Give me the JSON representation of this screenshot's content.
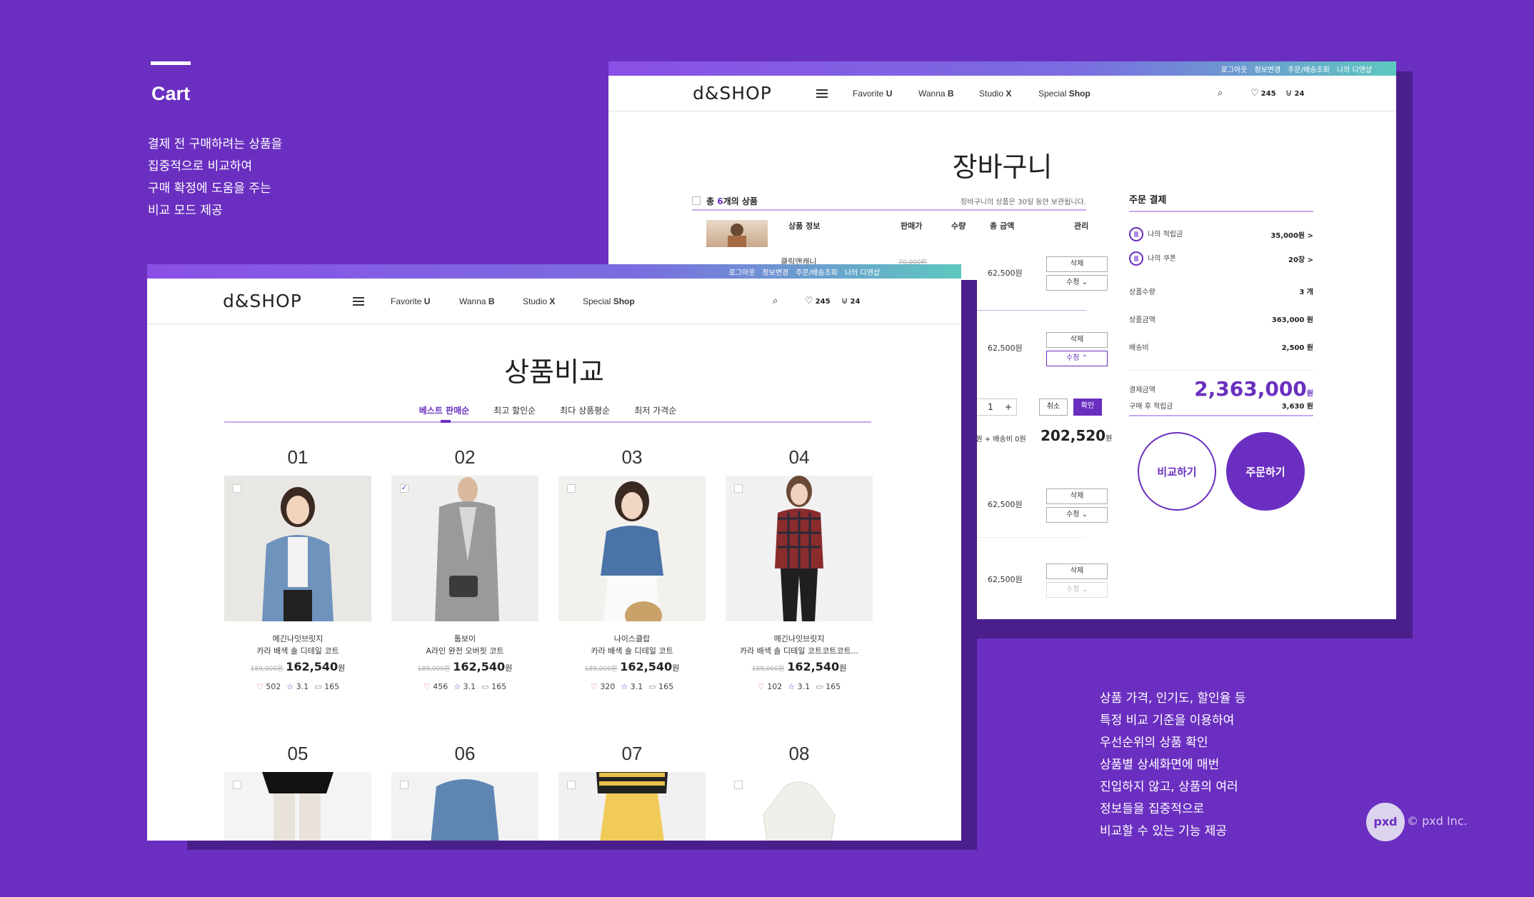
{
  "section": {
    "title": "Cart",
    "desc_left": [
      "결제 전 구매하려는 상품을",
      "집중적으로 비교하여",
      "구매 확정에 도움을 주는",
      "비교 모드 제공"
    ],
    "desc_right": [
      "상품 가격, 인기도, 할인율 등",
      "특정 비교 기준을 이용하여",
      "우선순위의 상품 확인",
      "상품별 상세화면에 매번",
      "진입하지 않고, 상품의 여러",
      "정보들을 집중적으로",
      "비교할 수 있는 기능 제공"
    ]
  },
  "header": {
    "top_links": [
      "로그아웃",
      "정보변경",
      "주문/배송조회",
      "나의 디앤샵"
    ],
    "logo": "d&SHOP",
    "nav": [
      {
        "pre": "Favorite ",
        "bold": "U"
      },
      {
        "pre": "Wanna ",
        "bold": "B"
      },
      {
        "pre": "Studio ",
        "bold": "X"
      },
      {
        "pre": "Special ",
        "bold": "Shop"
      }
    ],
    "wish_count": "245",
    "cart_count": "24"
  },
  "cart": {
    "title": "장바구니",
    "count_prefix": "총 ",
    "count": "6",
    "count_suffix": "개의 상품",
    "note": "장바구니의 상품은 30일 동안 보관됩니다.",
    "columns": [
      "상품 정보",
      "판매가",
      "수량",
      "총 금액",
      "관리"
    ],
    "first_item_name": "클릭앤캐니",
    "first_item_old": "70,000원",
    "row_price": "62,500원",
    "delete_label": "삭제",
    "edit_label": "수정",
    "qty_value": "1",
    "cancel_label": "취소",
    "confirm_label": "확인",
    "shipping_line": "0원 + 배송비 0원",
    "sum_total": "202,520",
    "won": "원"
  },
  "order": {
    "title": "주문 결제",
    "points_label": "나의 적립금",
    "points_value": "35,000원 >",
    "coupon_label": "나의 쿠폰",
    "coupon_value": "20장 >",
    "qty_label": "상품수량",
    "qty_value": "3 개",
    "amount_label": "상품금액",
    "amount_value": "363,000 원",
    "ship_label": "배송비",
    "ship_value": "2,500 원",
    "pay_label": "결제금액",
    "pay_value": "2,363,000",
    "pay_unit": "원",
    "after_label": "구매 후 적립금",
    "after_value": "3,630 원",
    "compare_btn": "비교하기",
    "order_btn": "주문하기"
  },
  "compare": {
    "title": "상품비교",
    "tabs": [
      "베스트 판매순",
      "최고 할인순",
      "최다 상품평순",
      "최저 가격순"
    ],
    "products": [
      {
        "num": "01",
        "brand": "메긴나잇브릿지",
        "name": "카라 배색 솔 디테일 코트",
        "old": "189,000원",
        "price": "162,540",
        "likes": "502",
        "rating": "3.1",
        "reviews": "165",
        "checked": ""
      },
      {
        "num": "02",
        "brand": "톰보이",
        "name": "A라인 완전 오버핏 코트",
        "old": "189,000원",
        "price": "162,540",
        "likes": "456",
        "rating": "3.1",
        "reviews": "165",
        "checked": "✓"
      },
      {
        "num": "03",
        "brand": "나이스클랍",
        "name": "카라 배색 솔 디테일 코트",
        "old": "189,000원",
        "price": "162,540",
        "likes": "320",
        "rating": "3.1",
        "reviews": "165",
        "checked": ""
      },
      {
        "num": "04",
        "brand": "메긴나잇브릿지",
        "name": "카라 배색 솔 디테일 코트코트코트...",
        "old": "189,000원",
        "price": "162,540",
        "likes": "102",
        "rating": "3.1",
        "reviews": "165",
        "checked": ""
      }
    ],
    "next_nums": [
      "05",
      "06",
      "07",
      "08"
    ],
    "won": "원"
  },
  "footer": {
    "logo": "pxd",
    "company": "© pxd Inc."
  },
  "colors": {
    "background": "#6a2fc0",
    "accent": "#6a2fc0",
    "line": "#c4a8ee"
  }
}
